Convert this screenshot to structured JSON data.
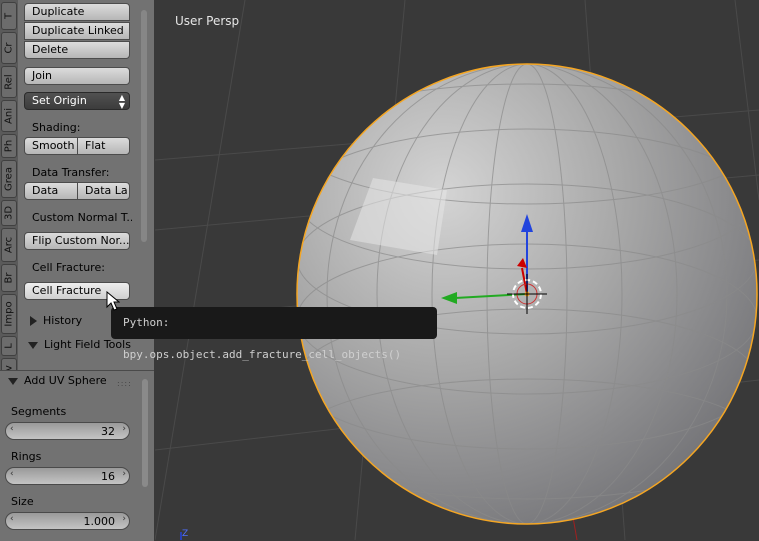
{
  "tabs": [
    "T",
    "Cr",
    "Rel",
    "Ani",
    "Ph",
    "Grea",
    "3D",
    "Arc",
    "Br",
    "Impo",
    "L",
    "Nav"
  ],
  "tool_shelf": {
    "duplicate_label": "Duplicate",
    "duplicate_linked_label": "Duplicate Linked",
    "delete_label": "Delete",
    "join_label": "Join",
    "set_origin_label": "Set Origin",
    "shading_label": "Shading:",
    "smooth_label": "Smooth",
    "flat_label": "Flat",
    "data_transfer_label": "Data Transfer:",
    "data_label": "Data",
    "data_layout_label": "Data La",
    "custom_normal_label": "Custom Normal T...",
    "flip_custom_label": "Flip Custom Nor...",
    "cell_fracture_header": "Cell Fracture:",
    "cell_fracture_button": "Cell Fracture",
    "history_label": "History",
    "light_field_label": "Light Field Tools"
  },
  "redo_panel": {
    "title": "Add UV Sphere",
    "segments_label": "Segments",
    "segments_value": "32",
    "rings_label": "Rings",
    "rings_value": "16",
    "size_label": "Size",
    "size_value": "1.000"
  },
  "viewport": {
    "view_label": "User Persp",
    "axis_label": "Z"
  },
  "tooltip": {
    "text": "Python: bpy.ops.object.add_fracture_cell_objects()"
  },
  "colors": {
    "background": "#393939",
    "selection_outline": "#f5a623",
    "gizmo_x": "#cc0000",
    "gizmo_y": "#22aa22",
    "gizmo_z": "#2244dd"
  }
}
